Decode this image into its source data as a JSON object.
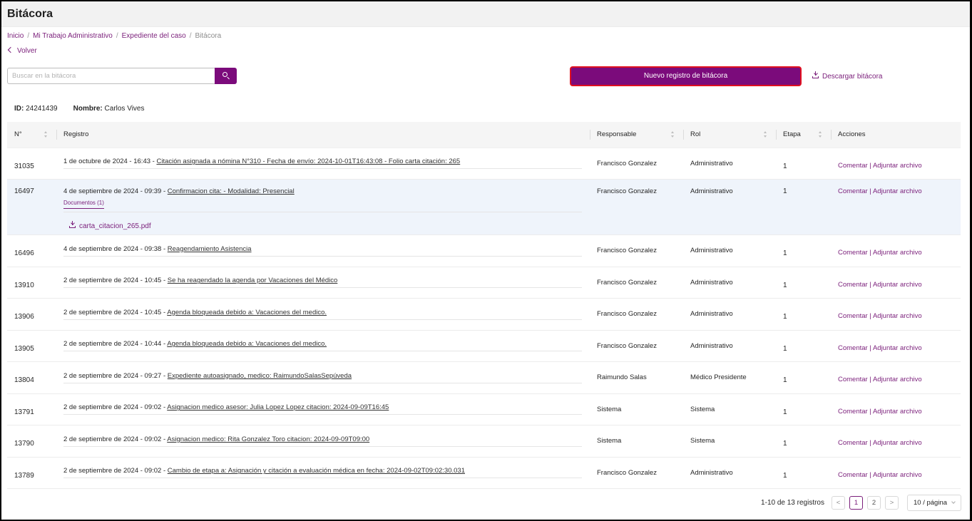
{
  "page_title": "Bitácora",
  "breadcrumb": {
    "items": [
      "Inicio",
      "Mi Trabajo Administrativo",
      "Expediente del caso"
    ],
    "current": "Bitácora",
    "separator": "/"
  },
  "back_label": "Volver",
  "search": {
    "placeholder": "Buscar en la bitácora",
    "value": ""
  },
  "new_button_label": "Nuevo registro de bitácora",
  "download_label": "Descargar bitácora",
  "record": {
    "id_label": "ID:",
    "id_value": "24241439",
    "name_label": "Nombre:",
    "name_value": "Carlos Vives"
  },
  "table": {
    "columns": [
      "N°",
      "Registro",
      "Responsable",
      "Rol",
      "Etapa",
      "Acciones"
    ],
    "actions": {
      "comment": "Comentar",
      "sep": "|",
      "attach": "Adjuntar archivo"
    },
    "rows": [
      {
        "num": "31035",
        "date": "1 de octubre de 2024 - 16:43 - ",
        "text": "Citación asignada a nómina N°310 - Fecha de envío: 2024-10-01T16:43:08 - Folio carta citación: 265",
        "responsable": "Francisco Gonzalez",
        "rol": "Administrativo",
        "etapa": "1"
      },
      {
        "num": "16497",
        "date": "4 de septiembre de 2024 - 09:39 - ",
        "text": "Confirmacion cita: - Modalidad: Presencial",
        "responsable": "Francisco Gonzalez",
        "rol": "Administrativo",
        "etapa": "1",
        "docs_tab": "Documentos (1)",
        "doc_file": "carta_citacion_265.pdf"
      },
      {
        "num": "16496",
        "date": "4 de septiembre de 2024 - 09:38 - ",
        "text": "Reagendamiento Asistencia",
        "responsable": "Francisco Gonzalez",
        "rol": "Administrativo",
        "etapa": "1"
      },
      {
        "num": "13910",
        "date": "2 de septiembre de 2024 - 10:45 - ",
        "text": "Se ha reagendado la agenda por Vacaciones del Médico",
        "responsable": "Francisco Gonzalez",
        "rol": "Administrativo",
        "etapa": "1"
      },
      {
        "num": "13906",
        "date": "2 de septiembre de 2024 - 10:45 - ",
        "text": "Agenda bloqueada debido a: Vacaciones del medico.",
        "responsable": "Francisco Gonzalez",
        "rol": "Administrativo",
        "etapa": "1"
      },
      {
        "num": "13905",
        "date": "2 de septiembre de 2024 - 10:44 - ",
        "text": "Agenda bloqueada debido a: Vacaciones del medico.",
        "responsable": "Francisco Gonzalez",
        "rol": "Administrativo",
        "etapa": "1"
      },
      {
        "num": "13804",
        "date": "2 de septiembre de 2024 - 09:27 - ",
        "text": "Expediente autoasignado, medico: RaimundoSalasSepúveda",
        "responsable": "Raimundo Salas",
        "rol": "Médico Presidente",
        "etapa": "1"
      },
      {
        "num": "13791",
        "date": "2 de septiembre de 2024 - 09:02 - ",
        "text": "Asignacion medico asesor: Julia Lopez Lopez citacion: 2024-09-09T16:45",
        "responsable": "Sistema",
        "rol": "Sistema",
        "etapa": "1"
      },
      {
        "num": "13790",
        "date": "2 de septiembre de 2024 - 09:02 - ",
        "text": "Asignacion medico: Rita Gonzalez Toro citacion: 2024-09-09T09:00",
        "responsable": "Sistema",
        "rol": "Sistema",
        "etapa": "1"
      },
      {
        "num": "13789",
        "date": "2 de septiembre de 2024 - 09:02 - ",
        "text": "Cambio de etapa a: Asignación y citación a evaluación médica en fecha: 2024-09-02T09:02:30.031",
        "responsable": "Francisco Gonzalez",
        "rol": "Administrativo",
        "etapa": "1"
      }
    ]
  },
  "pagination": {
    "summary": "1-10 de 13 registros",
    "prev": "<",
    "next": ">",
    "pages": [
      "1",
      "2"
    ],
    "current_page": "1",
    "page_size": "10 / página"
  }
}
